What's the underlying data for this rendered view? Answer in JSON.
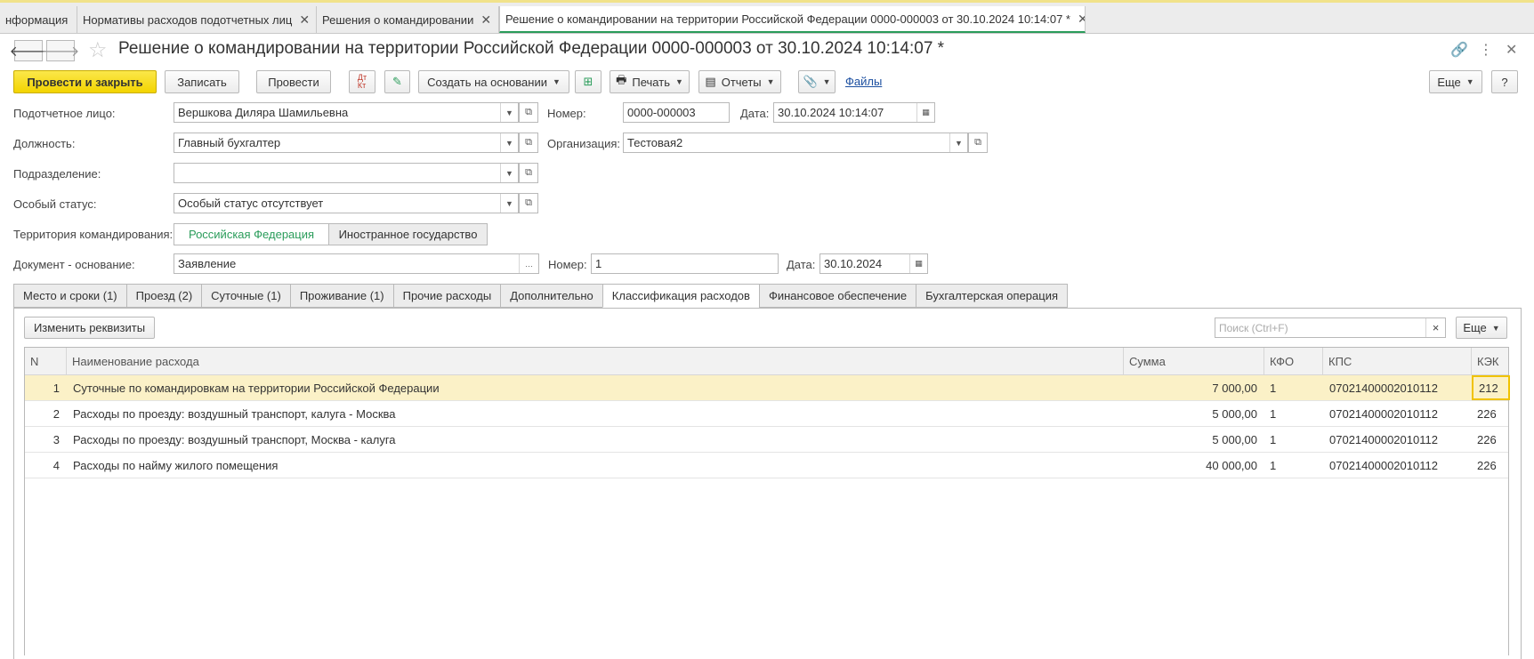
{
  "window_tabs": [
    {
      "label": "нформация"
    },
    {
      "label": "Нормативы расходов подотчетных лиц"
    },
    {
      "label": "Решения о командировании"
    },
    {
      "label": "Решение о командировании на территории Российской Федерации 0000-000003 от 30.10.2024 10:14:07 *"
    }
  ],
  "header": {
    "title": "Решение о командировании на территории Российской Федерации 0000-000003 от 30.10.2024 10:14:07 *"
  },
  "toolbar": {
    "post_close": "Провести и закрыть",
    "save": "Записать",
    "post": "Провести",
    "create_based": "Создать на основании",
    "print": "Печать",
    "reports": "Отчеты",
    "files": "Файлы",
    "more": "Еще",
    "help": "?"
  },
  "form": {
    "employee_label": "Подотчетное лицо:",
    "employee_value": "Вершкова Диляра Шамильевна",
    "number_label": "Номер:",
    "number_value": "0000-000003",
    "date_label": "Дата:",
    "date_value": "30.10.2024 10:14:07",
    "position_label": "Должность:",
    "position_value": "Главный бухгалтер",
    "org_label": "Организация:",
    "org_value": "Тестовая2",
    "department_label": "Подразделение:",
    "department_value": "",
    "status_label": "Особый статус:",
    "status_value": "Особый статус отсутствует",
    "territory_label": "Территория командирования:",
    "territory_options": [
      "Российская Федерация",
      "Иностранное государство"
    ],
    "basis_label": "Документ - основание:",
    "basis_value": "Заявление",
    "basis_number_label": "Номер:",
    "basis_number_value": "1",
    "basis_date_label": "Дата:",
    "basis_date_value": "30.10.2024"
  },
  "tabs": [
    {
      "label": "Место и сроки (1)"
    },
    {
      "label": "Проезд (2)"
    },
    {
      "label": "Суточные (1)"
    },
    {
      "label": "Проживание (1)"
    },
    {
      "label": "Прочие расходы"
    },
    {
      "label": "Дополнительно"
    },
    {
      "label": "Классификация расходов"
    },
    {
      "label": "Финансовое обеспечение"
    },
    {
      "label": "Бухгалтерская операция"
    }
  ],
  "panel": {
    "change_button": "Изменить реквизиты",
    "search_placeholder": "Поиск (Ctrl+F)",
    "search_clear": "×",
    "more": "Еще"
  },
  "table": {
    "columns": [
      "N",
      "Наименование расхода",
      "Сумма",
      "КФО",
      "КПС",
      "КЭК"
    ],
    "rows": [
      {
        "n": "1",
        "name": "Суточные по командировкам на территории Российской Федерации",
        "sum": "7 000,00",
        "kfo": "1",
        "kps": "07021400002010112",
        "kek": "212"
      },
      {
        "n": "2",
        "name": "Расходы по проезду: воздушный транспорт, калуга - Москва",
        "sum": "5 000,00",
        "kfo": "1",
        "kps": "07021400002010112",
        "kek": "226"
      },
      {
        "n": "3",
        "name": "Расходы по проезду: воздушный транспорт, Москва - калуга",
        "sum": "5 000,00",
        "kfo": "1",
        "kps": "07021400002010112",
        "kek": "226"
      },
      {
        "n": "4",
        "name": "Расходы по найму жилого помещения",
        "sum": "40 000,00",
        "kfo": "1",
        "kps": "07021400002010112",
        "kek": "226"
      }
    ]
  },
  "colors": {
    "primary_button": "#f3d400",
    "active_tab_accent": "#2a9c5a",
    "selected_row": "#fbf1c7",
    "link": "#1c4fa0"
  }
}
